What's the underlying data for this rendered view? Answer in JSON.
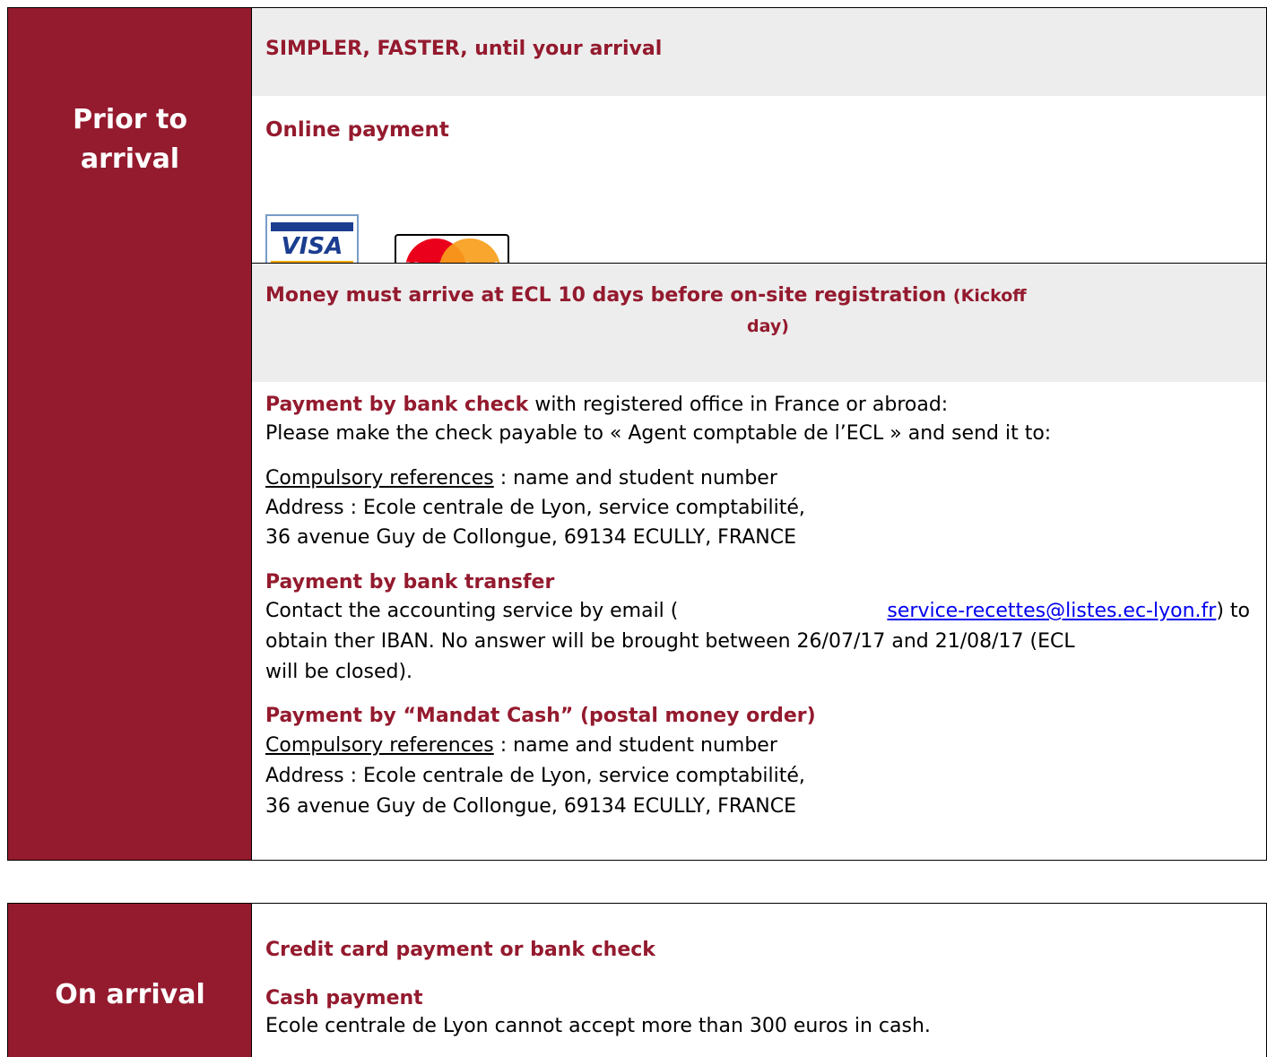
{
  "prior": {
    "label_line1": "Prior to",
    "label_line2": "arrival",
    "tagline": "SIMPLER, FASTER, until your  arrival",
    "online_title": "Online payment",
    "visa_word": "VISA",
    "mastercard_word": "MasterCard",
    "deadline_main": "Money must arrive at ECL 10 days before on-site registration",
    "deadline_small1": "(Kickoff",
    "deadline_small2": "day)",
    "check": {
      "title": "Payment by bank check",
      "title_rest": " with registered office in France or abroad:",
      "line2": "Please make the check payable to « Agent comptable de l’ECL » and send it to:",
      "ref_label": "Compulsory references",
      "ref_rest": "  : name and student number",
      "address1": "Address : Ecole centrale de Lyon, service comptabilité,",
      "address2": "36 avenue Guy de Collongue, 69134 ECULLY, FRANCE"
    },
    "transfer": {
      "title": "Payment by bank transfer",
      "line1_pre": "Contact the accounting service by email (",
      "email": "service-recettes@listes.ec-lyon.fr",
      "line1_post": ") to",
      "line2": "obtain ther IBAN. No answer will be brought between 26/07/17 and 21/08/17 (ECL",
      "line3": "will be closed)."
    },
    "mandat": {
      "title": "Payment by “Mandat Cash” (postal money order)",
      "ref_label": "Compulsory references",
      "ref_rest": "  : name and student number",
      "address1": "Address : Ecole centrale de Lyon, service comptabilité,",
      "address2": "36 avenue Guy de Collongue, 69134 ECULLY, FRANCE"
    }
  },
  "on_arrival": {
    "label": "On arrival",
    "card_title": "Credit card payment or bank check",
    "cash_title": "Cash payment",
    "cash_text": "Ecole centrale de Lyon cannot accept more than 300 euros in cash."
  },
  "colors": {
    "brand": "#941A2E",
    "grey_cell": "#EDEDED",
    "link": "#0000EE"
  }
}
